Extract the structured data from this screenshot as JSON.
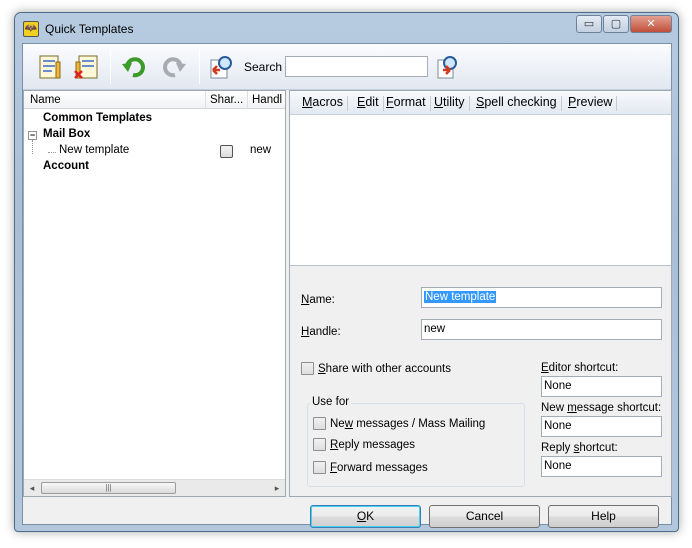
{
  "window": {
    "title": "Quick Templates",
    "app_icon_glyph": "🦇",
    "minimize_glyph": "▭",
    "maximize_glyph": "▢",
    "close_glyph": "✕"
  },
  "toolbar": {
    "search_label": "Search",
    "search_value": "",
    "icons": [
      "new-template-icon",
      "delete-template-icon",
      "undo-icon",
      "redo-icon",
      "find-icon",
      "search-go-icon"
    ]
  },
  "tree": {
    "columns": [
      "Name",
      "Shar...",
      "Handl"
    ],
    "items": [
      {
        "label": "Common Templates",
        "bold": true
      },
      {
        "label": "Mail Box",
        "bold": true,
        "expander": "−"
      },
      {
        "label": "New template",
        "handle": "new",
        "shared": false
      },
      {
        "label": "Account",
        "bold": true
      }
    ],
    "scroll_left": "◂",
    "scroll_right": "▸",
    "scroll_grip": "|||"
  },
  "editor": {
    "menu": [
      {
        "pre": "",
        "u": "M",
        "post": "acros"
      },
      {
        "pre": "",
        "u": "E",
        "post": "dit"
      },
      {
        "pre": "",
        "u": "F",
        "post": "ormat"
      },
      {
        "pre": "",
        "u": "U",
        "post": "tility"
      },
      {
        "pre": "",
        "u": "S",
        "post": "pell checking"
      },
      {
        "pre": "",
        "u": "P",
        "post": "review"
      }
    ]
  },
  "form": {
    "name_label_u": "N",
    "name_label_rest": "ame:",
    "name_value": "New template",
    "handle_label_u": "H",
    "handle_label_rest": "andle:",
    "handle_value": "new",
    "share_u": "S",
    "share_rest": "hare with other accounts",
    "share_checked": false,
    "use_for_title": "Use for",
    "use_new_pre": "Ne",
    "use_new_u": "w",
    "use_new_post": " messages / Mass Mailing",
    "use_reply_u": "R",
    "use_reply_rest": "eply messages",
    "use_forward_u": "F",
    "use_forward_rest": "orward messages",
    "editor_shortcut_u": "E",
    "editor_shortcut_rest": "ditor shortcut:",
    "editor_shortcut_value": "None",
    "new_msg_pre": "New ",
    "new_msg_u": "m",
    "new_msg_post": "essage shortcut:",
    "new_msg_value": "None",
    "reply_shortcut_pre": "Reply ",
    "reply_shortcut_u": "s",
    "reply_shortcut_post": "hortcut:",
    "reply_shortcut_value": "None"
  },
  "buttons": {
    "ok_u": "O",
    "ok_rest": "K",
    "cancel": "Cancel",
    "help": "Help"
  }
}
